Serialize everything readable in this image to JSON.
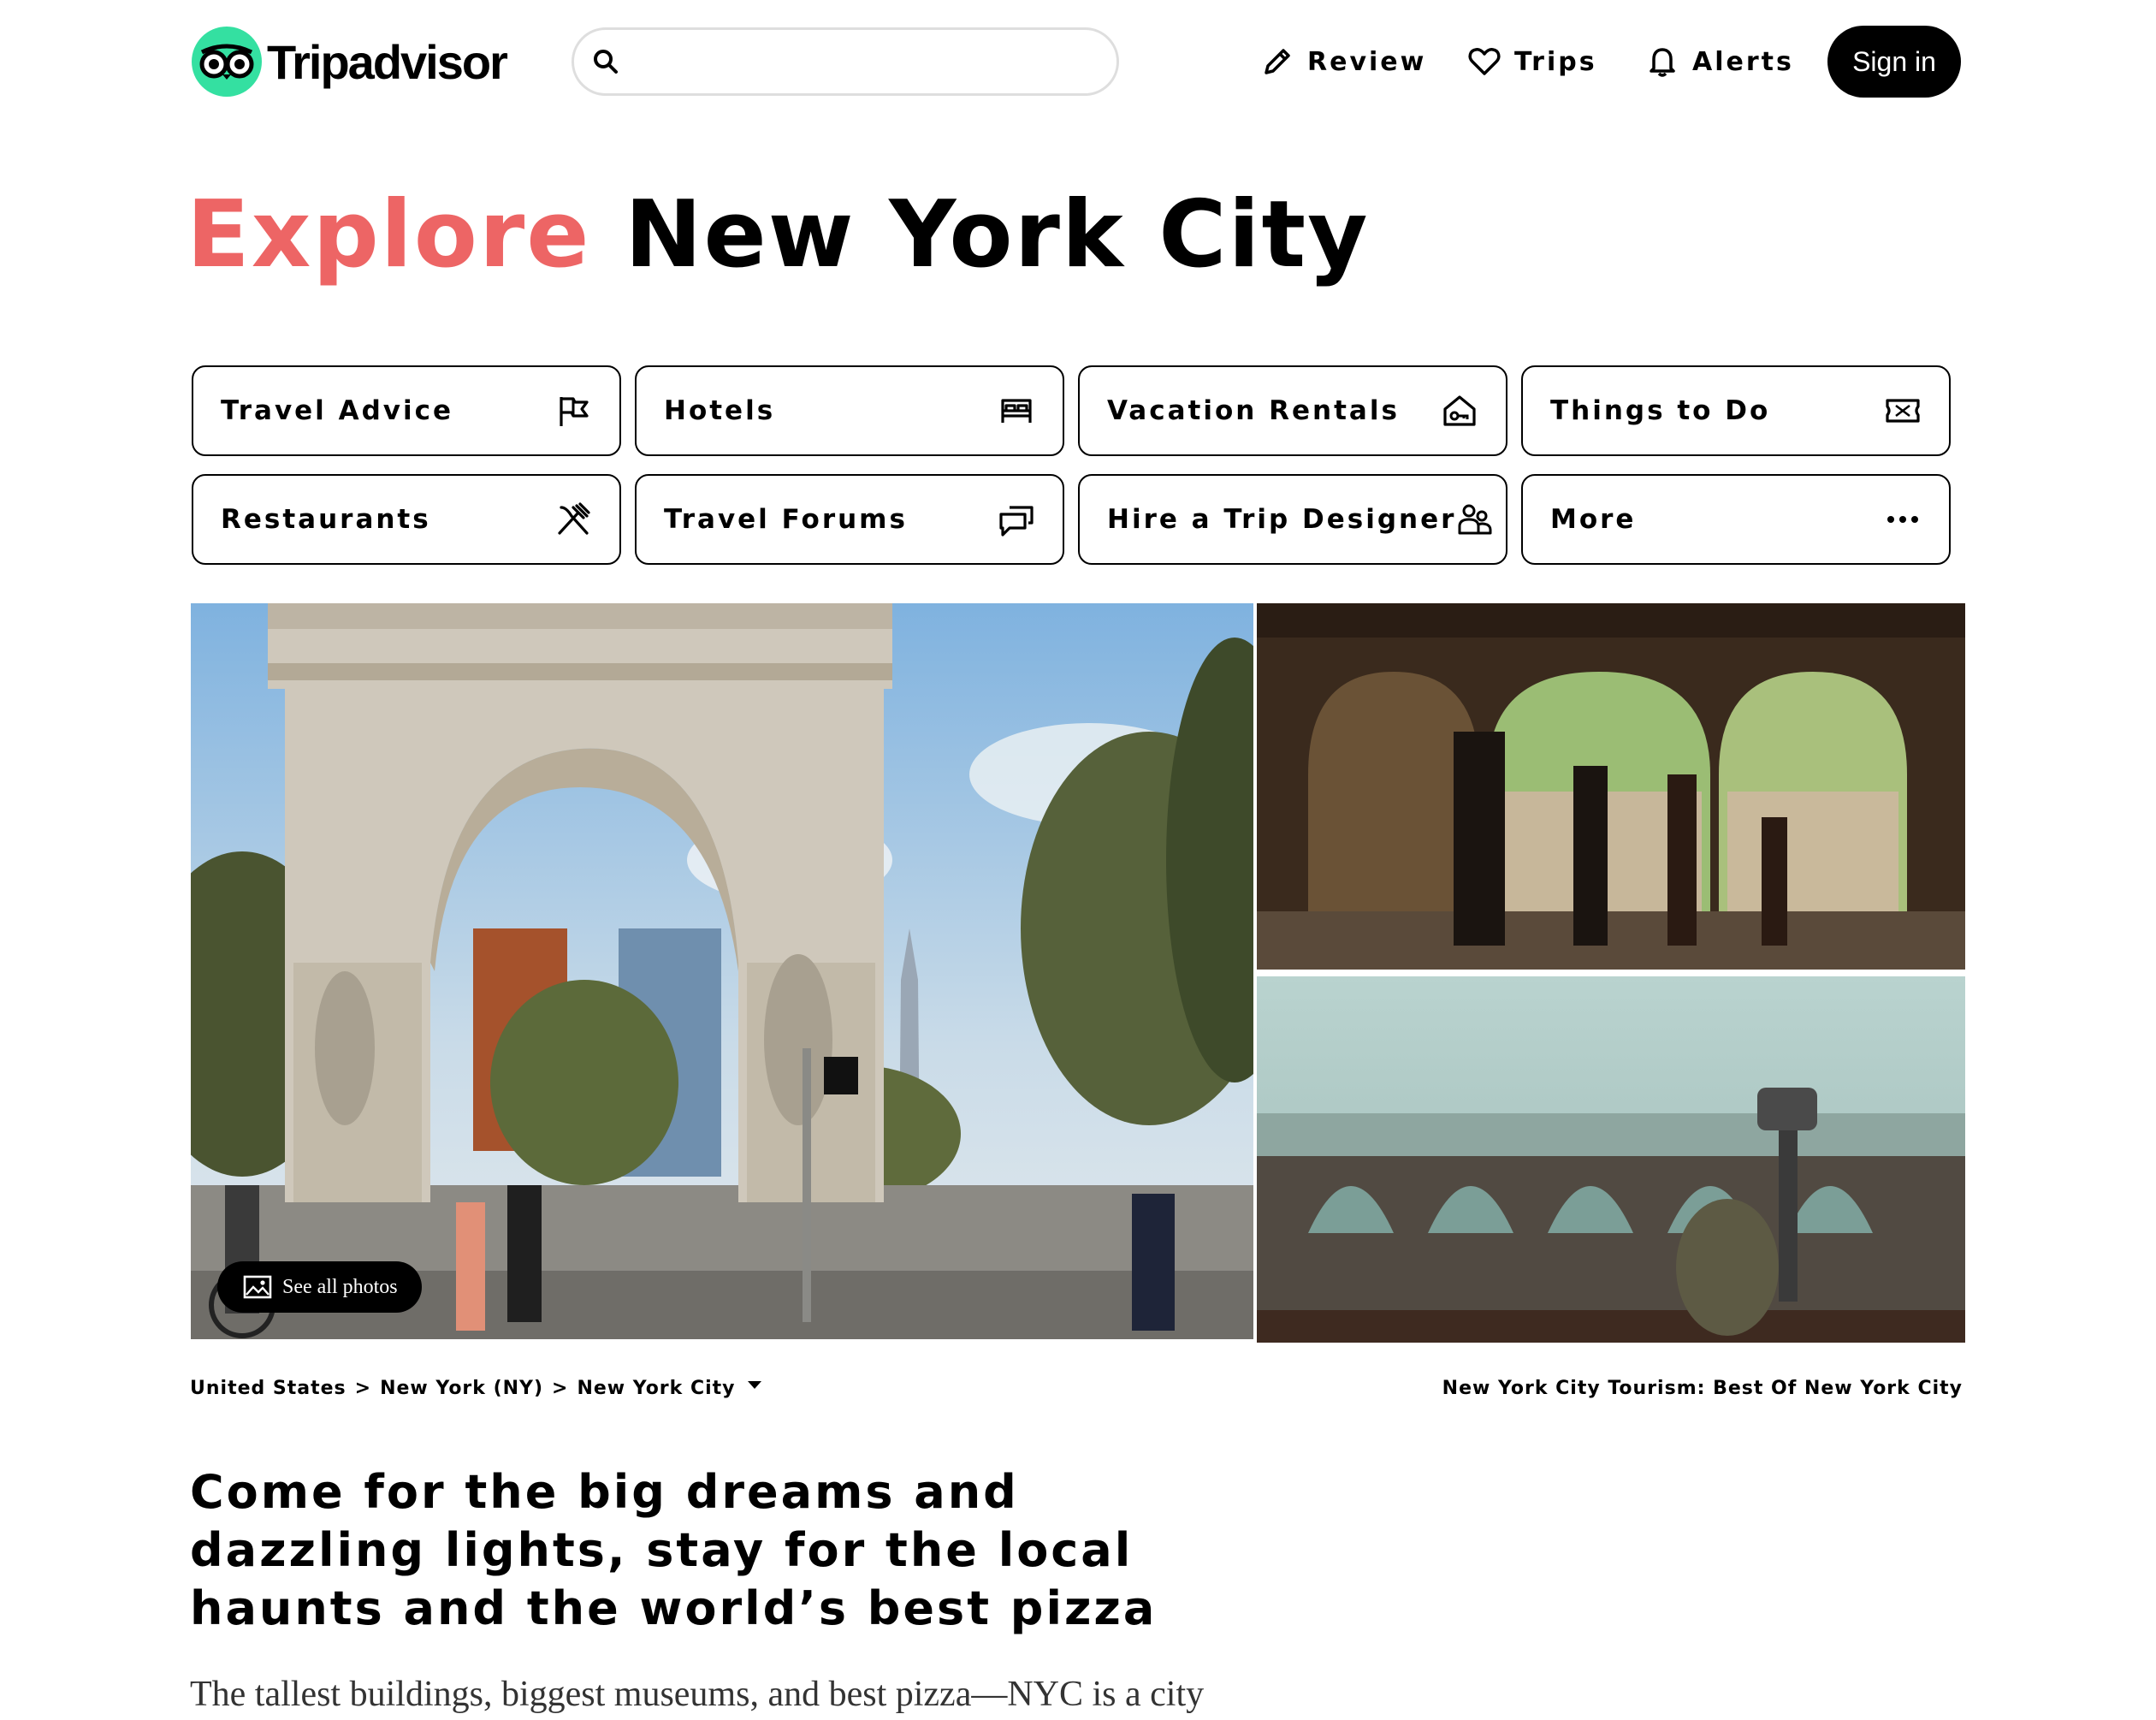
{
  "header": {
    "logo_text": "Tripadvisor",
    "search_placeholder": "",
    "nav": {
      "review": "Review",
      "trips": "Trips",
      "alerts": "Alerts"
    },
    "signin_label": "Sign in"
  },
  "title": {
    "accent": "Explore",
    "rest": "New York City"
  },
  "categories": [
    {
      "label": "Travel Advice",
      "icon": "flag-icon"
    },
    {
      "label": "Hotels",
      "icon": "bed-icon"
    },
    {
      "label": "Vacation Rentals",
      "icon": "house-key-icon"
    },
    {
      "label": "Things to Do",
      "icon": "ticket-icon"
    },
    {
      "label": "Restaurants",
      "icon": "fork-knife-icon"
    },
    {
      "label": "Travel Forums",
      "icon": "chat-bubbles-icon"
    },
    {
      "label": "Hire a Trip Designer",
      "icon": "people-icon"
    },
    {
      "label": "More",
      "icon": "more-dots-icon"
    }
  ],
  "photos": {
    "see_all_label": "See all photos"
  },
  "breadcrumb": {
    "items": [
      "United States",
      "New York (NY)",
      "New York City"
    ],
    "separator": ">"
  },
  "tourism_label": "New York City Tourism: Best Of New York City",
  "headline": "Come for the big dreams and dazzling lights, stay for the local haunts and the world’s best pizza",
  "body_text": "The tallest buildings, biggest museums, and best pizza—NYC is a city",
  "colors": {
    "accent": "#ed6565",
    "logo_green": "#34e0a1",
    "button_black": "#000000"
  }
}
